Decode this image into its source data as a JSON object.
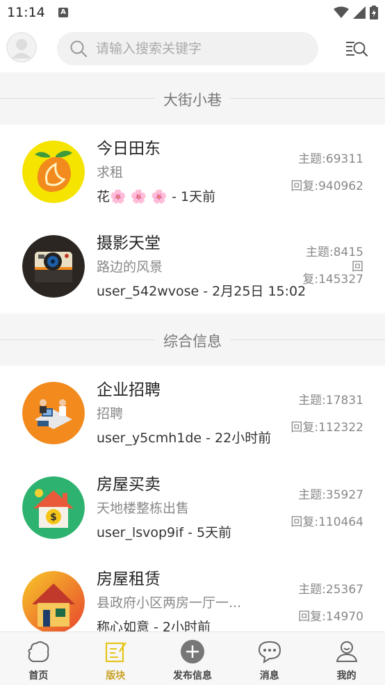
{
  "status_bar": {
    "time": "11:14"
  },
  "header": {
    "search_placeholder": "请输入搜索关键字"
  },
  "sections": [
    {
      "title": "大街小巷",
      "forums": [
        {
          "name": "今日田东",
          "subtitle": "求租",
          "meta": "花🌸 🌸 🌸 - 1天前",
          "topics": "主题:69311",
          "replies": "回复:940962"
        },
        {
          "name": "摄影天堂",
          "subtitle": "路边的风景",
          "meta": "user_542wvose - 2月25日 15:02",
          "topics": "主题:8415",
          "replies_a": "回",
          "replies_b": "复:145327"
        }
      ]
    },
    {
      "title": "综合信息",
      "forums": [
        {
          "name": "企业招聘",
          "subtitle": "招聘",
          "meta": "user_y5cmh1de - 22小时前",
          "topics": "主题:17831",
          "replies": "回复:112322"
        },
        {
          "name": "房屋买卖",
          "subtitle": "天地楼整栋出售",
          "meta": "user_lsvop9if - 5天前",
          "topics": "主题:35927",
          "replies": "回复:110464"
        },
        {
          "name": "房屋租赁",
          "subtitle": "县政府小区两房一厅一...",
          "meta": "称心如意 - 2小时前",
          "topics": "主题:25367",
          "replies": "回复:14970"
        }
      ]
    }
  ],
  "tabs": [
    {
      "label": "首页"
    },
    {
      "label": "版块",
      "active": true
    },
    {
      "label": "发布信息"
    },
    {
      "label": "消息"
    },
    {
      "label": "我的"
    }
  ],
  "colors": {
    "accent": "#c9a227",
    "logo_yellow": "#f5e400",
    "logo_orange": "#f28a1d",
    "logo_green": "#2db36f"
  }
}
